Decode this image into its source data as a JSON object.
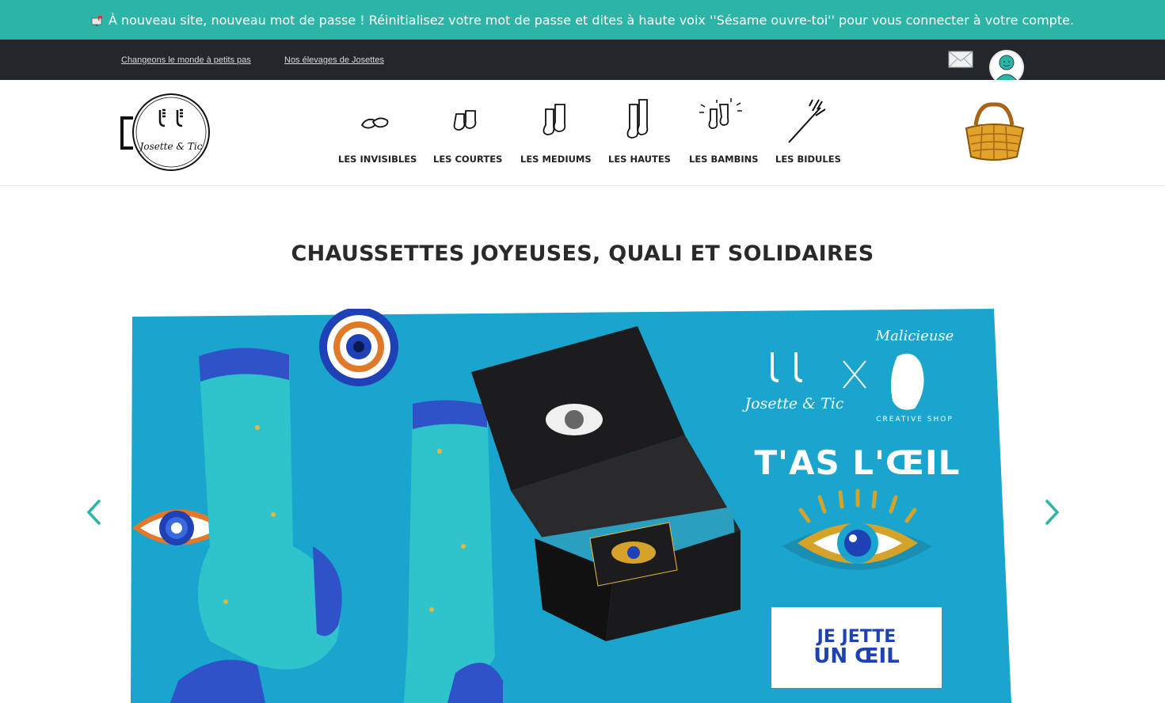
{
  "announcement": {
    "icon": "mailbox-icon",
    "text": "À nouveau site, nouveau mot de passe ! Réinitialisez votre mot de passe et dites à haute voix ''Sésame ouvre-toi'' pour vous connecter à votre compte."
  },
  "topbar": {
    "links": [
      "Changeons le monde à petits pas",
      "Nos élevages de Josettes"
    ],
    "icons": [
      "envelope-icon",
      "user-avatar-icon"
    ]
  },
  "header": {
    "logo_text": "Josette & Tic",
    "nav": [
      {
        "label": "LES INVISIBLES",
        "icon": "invisible-socks-icon"
      },
      {
        "label": "LES COURTES",
        "icon": "short-socks-icon"
      },
      {
        "label": "LES MEDIUMS",
        "icon": "medium-socks-icon"
      },
      {
        "label": "LES HAUTES",
        "icon": "high-socks-icon"
      },
      {
        "label": "LES BAMBINS",
        "icon": "kids-socks-icon"
      },
      {
        "label": "LES BIDULES",
        "icon": "gadgets-icon"
      }
    ],
    "basket_icon": "basket-icon"
  },
  "main": {
    "title": "CHAUSSETTES JOYEUSES, QUALI ET SOLIDAIRES"
  },
  "banner": {
    "brand_left": "Josette & Tic",
    "brand_right": "Malicieuse",
    "brand_right_sub": "CREATIVE SHOP",
    "headline": "T'AS L'ŒIL",
    "cta_line1": "JE JETTE",
    "cta_line2": "UN ŒIL",
    "colors": {
      "background": "#1aa5cf",
      "accent": "#1e41b6",
      "gold": "#d6a32a",
      "orange": "#e07a2a"
    }
  },
  "carousel": {
    "prev_icon": "chevron-left-icon",
    "next_icon": "chevron-right-icon"
  }
}
